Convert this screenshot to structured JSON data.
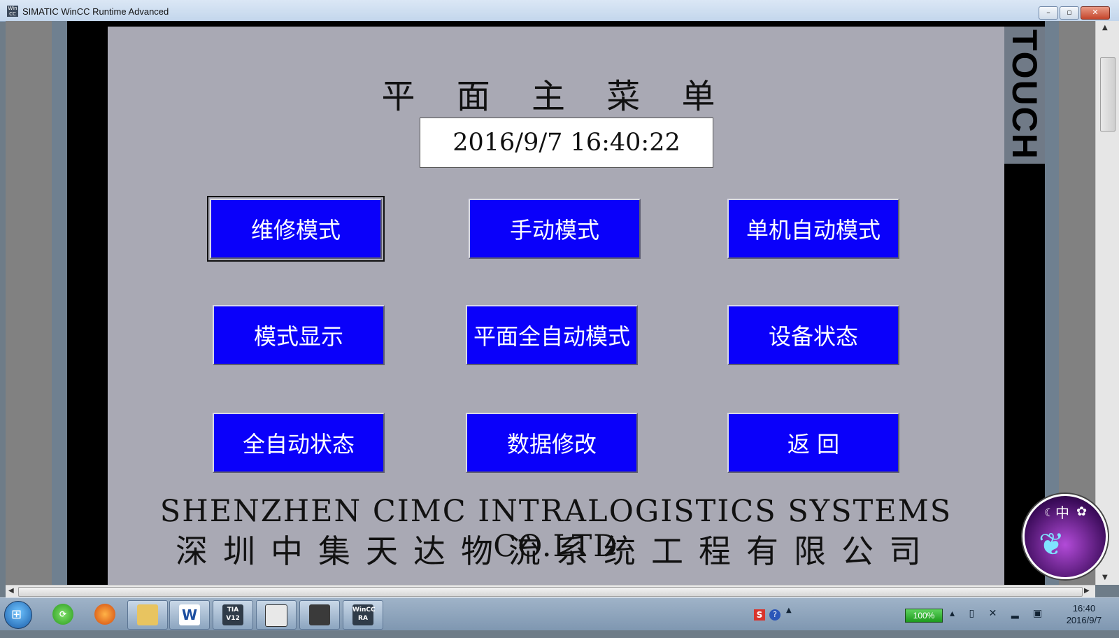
{
  "window": {
    "title": "SIMATIC WinCC Runtime Advanced",
    "icon": "wincc-app-icon",
    "controls": {
      "minimize": "–",
      "maximize": "▫",
      "close": "✕"
    }
  },
  "hmi": {
    "title": "平 面 主 菜 单",
    "datetime": "2016/9/7  16:40:22",
    "touch_label": "TOUCH",
    "buttons": [
      {
        "label": "维修模式",
        "focused": true
      },
      {
        "label": "手动模式"
      },
      {
        "label": "单机自动模式"
      },
      {
        "label": "模式显示"
      },
      {
        "label": "平面全自动模式"
      },
      {
        "label": "设备状态"
      },
      {
        "label": "全自动状态"
      },
      {
        "label": "数据修改"
      },
      {
        "label": "返    回"
      }
    ],
    "company_en": "SHENZHEN CIMC INTRALOGISTICS SYSTEMS CO.LTD",
    "company_cn": "深圳中集天达物流系统工程有限公司"
  },
  "ime_widget": {
    "char": "中",
    "icons": [
      "moon-icon",
      "gear-icon",
      "butterfly-icon"
    ]
  },
  "taskbar": {
    "apps": [
      {
        "name": "start-button",
        "icon": "windows-flag-icon"
      },
      {
        "name": "refresh-app",
        "icon": "green-refresh-icon"
      },
      {
        "name": "firefox",
        "icon": "firefox-icon"
      },
      {
        "name": "explorer",
        "icon": "folder-icon"
      },
      {
        "name": "word",
        "icon": "word-icon",
        "label": "W"
      },
      {
        "name": "tia-portal",
        "icon": "tia-icon",
        "label": "TIA V12"
      },
      {
        "name": "tool",
        "icon": "tool-icon"
      },
      {
        "name": "simulator",
        "icon": "plc-icon"
      },
      {
        "name": "wincc-ra",
        "icon": "wincc-icon",
        "label": "WinCC RA"
      }
    ],
    "battery": "100%",
    "clock_time": "16:40",
    "clock_date": "2016/9/7"
  },
  "colors": {
    "button_blue": "#0a00fa",
    "hmi_background": "#a9a9b4",
    "frame_black": "#000000"
  }
}
